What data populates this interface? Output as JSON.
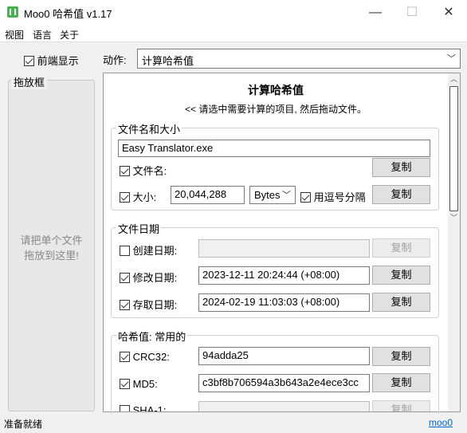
{
  "window": {
    "title": "Moo0 哈希值 v1.17",
    "minimize": "—",
    "maximize": "☐",
    "close": "✕"
  },
  "menu": [
    "视图",
    "语言",
    "关于"
  ],
  "sidebar": {
    "frontmost_label": "前端显示",
    "frontmost_checked": true,
    "dragbox_title": "拖放框",
    "dragbox_hint_line1": "请把单个文件",
    "dragbox_hint_line2": "拖放到这里!"
  },
  "action": {
    "label": "动作:",
    "value": "计算哈希值"
  },
  "panel": {
    "title": "计算哈希值",
    "subtitle": "<< 请选中需要计算的项目, 然后拖动文件。"
  },
  "file_group": {
    "title": "文件名和大小",
    "path": "Easy Translator.exe",
    "filename_label": "文件名:",
    "size_label": "大小:",
    "size_value": "20,044,288",
    "unit": "Bytes",
    "comma_label": "用逗号分隔",
    "copy": "复制"
  },
  "date_group": {
    "title": "文件日期",
    "created_label": "创建日期:",
    "created_value": "",
    "modified_label": "修改日期:",
    "modified_value": "2023-12-11 20:24:44 (+08:00)",
    "accessed_label": "存取日期:",
    "accessed_value": "2024-02-19 11:03:03 (+08:00)",
    "copy": "复制"
  },
  "hash_group": {
    "title": "哈希值: 常用的",
    "crc32_label": "CRC32:",
    "crc32_value": "94adda25",
    "md5_label": "MD5:",
    "md5_value": "c3bf8b706594a3b643a2e4ece3cc",
    "sha1_label": "SHA-1:",
    "copy": "复制"
  },
  "status": {
    "text": "准备就绪",
    "link": "moo0"
  }
}
